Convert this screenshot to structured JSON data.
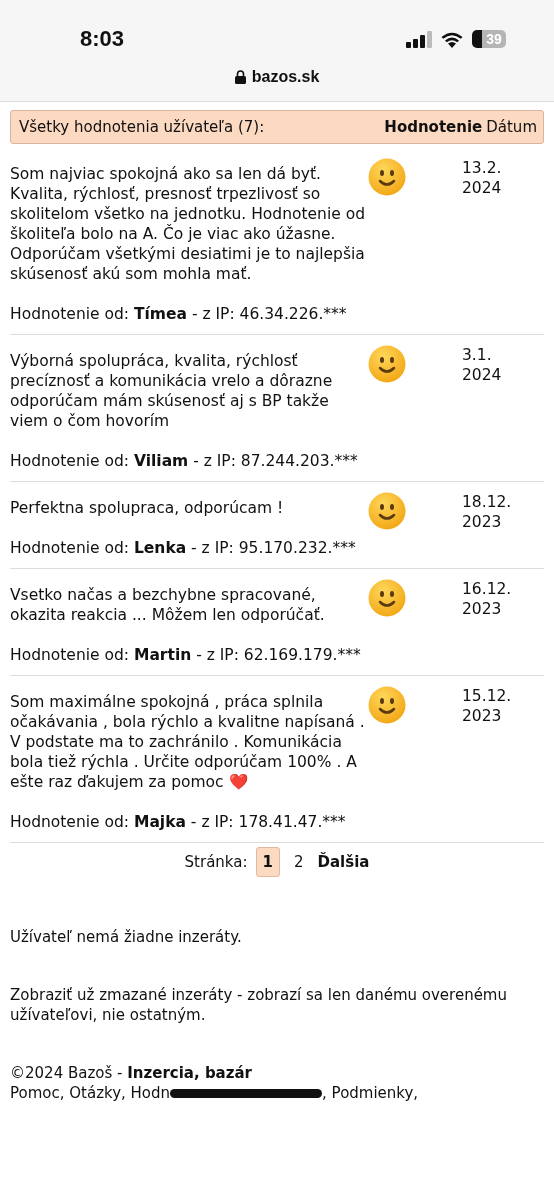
{
  "status_bar": {
    "time": "8:03",
    "battery": "39"
  },
  "address_bar": {
    "url": "bazos.sk"
  },
  "ratings_header": {
    "title": "Všetky hodnotenia užívateľa (7):",
    "columns": [
      "Hodnotenie",
      "Dátum"
    ]
  },
  "ratings": [
    {
      "text": "Som najviac spokojná ako sa len dá byť. Kvalita, rýchlosť, presnosť trpezlivosť so skolitelom všetko na jednotku. Hodnotenie od školiteľa bolo na A. Čo je viac ako úžasne. Odporúčam všetkými desiatimi je to najlepšia skúsenosť akú som mohla mať.",
      "author_line": "Hodnotenie od: **Tímea** - z IP: 46.34.226.***",
      "kind": "positive",
      "date": "13.2. 2024"
    },
    {
      "text": "Výborná spolupráca, kvalita, rýchlosť precíznosť a komunikácia vrelo a dôrazne odporúčam mám skúsenosť aj s BP takže viem o čom hovorím",
      "author_line": "Hodnotenie od: **Viliam** - z IP: 87.244.203.***",
      "kind": "positive",
      "date": "3.1. 2024"
    },
    {
      "text": "Perfektna spolupraca, odporúcam !",
      "author_line": "Hodnotenie od: **Lenka** - z IP: 95.170.232.***",
      "kind": "positive",
      "date": "18.12. 2023"
    },
    {
      "text": "Vsetko načas a bezchybne spracované, okazita reakcia ... Môžem len odporúčať.",
      "author_line": "Hodnotenie od: **Martin** - z IP: 62.169.179.***",
      "kind": "positive",
      "date": "16.12. 2023"
    },
    {
      "text": "Som maximálne spokojná , práca splnila očakávania , bola rýchlo a kvalitne napísaná . V podstate ma to zachránilo . Komunikácia bola tiež rýchla . Určite odporúčam 100% . A ešte raz ďakujem za pomoc ❤️",
      "author_line": "Hodnotenie od: **Majka** - z IP: 178.41.47.***",
      "kind": "positive",
      "date": "15.12. 2023"
    }
  ],
  "pagination": {
    "label": "Stránka:",
    "pages": [
      {
        "label": "1",
        "selected": true
      },
      {
        "label": "2",
        "selected": false
      }
    ],
    "next": "Ďalšia"
  },
  "no_ads_message": "Užívateľ nemá žiadne inzeráty.",
  "deleted_ads_link": "Zobraziť už zmazané inzeráty - zobrazí sa len danému overenému užívateľovi, nie ostatným.",
  "footer": {
    "copyright": "©2024 Bazoš - **Inzercia, bazár**",
    "links_before": "Pomoc, Otázky, Hodn",
    "links_after": ", Podmienky,"
  }
}
